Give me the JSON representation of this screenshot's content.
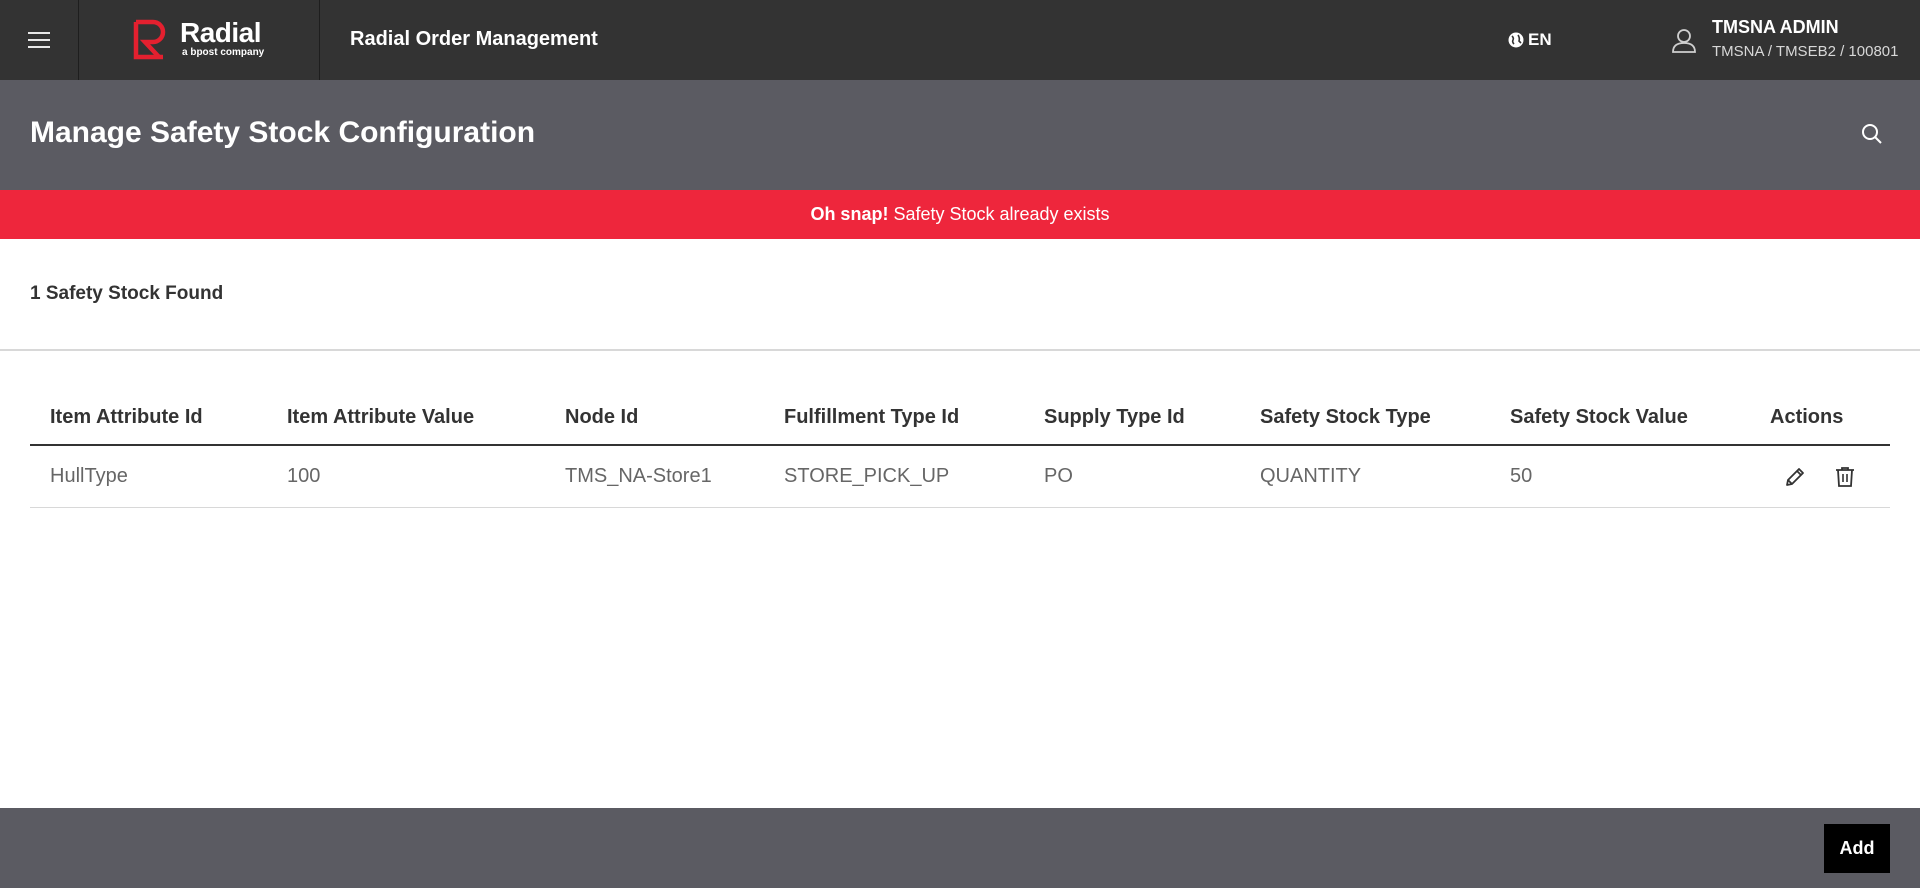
{
  "header": {
    "brand_name": "Radial",
    "brand_tagline": "a bpost company",
    "app_title": "Radial Order Management",
    "language": "EN",
    "user_name": "TMSNA ADMIN",
    "user_org": "TMSNA / TMSEB2 / 100801",
    "icons": {
      "menu": "hamburger-icon",
      "language": "globe-icon",
      "user": "user-icon",
      "search": "search-icon"
    }
  },
  "page": {
    "title": "Manage Safety Stock Configuration"
  },
  "alert": {
    "strong": "Oh snap!",
    "message": "Safety Stock already exists",
    "color": "#ee263c"
  },
  "results": {
    "count_text": "1 Safety Stock Found"
  },
  "table": {
    "columns": [
      "Item Attribute Id",
      "Item Attribute Value",
      "Node Id",
      "Fulfillment Type Id",
      "Supply Type Id",
      "Safety Stock Type",
      "Safety Stock Value",
      "Actions"
    ],
    "rows": [
      [
        "HullType",
        "100",
        "TMS_NA-Store1",
        "STORE_PICK_UP",
        "PO",
        "QUANTITY",
        "50"
      ]
    ],
    "row_actions": [
      "edit-icon",
      "trash-icon"
    ]
  },
  "footer": {
    "add_label": "Add"
  },
  "colors": {
    "topbar": "#333333",
    "page_header": "#5b5b62",
    "brand_red": "#e4202f"
  }
}
